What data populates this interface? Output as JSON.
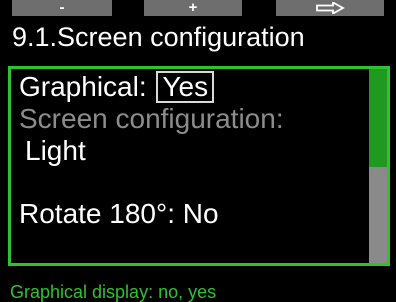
{
  "softkeys": {
    "left_label": "-",
    "middle_label": "+",
    "right_icon": "right-arrow-icon"
  },
  "screen": {
    "title": "9.1.Screen configuration"
  },
  "settings": {
    "graphical_label": "Graphical:",
    "graphical_value": "Yes",
    "screen_config_label": "Screen configuration:",
    "screen_config_value": "Light",
    "rotate_label": "Rotate 180°:",
    "rotate_value": "No"
  },
  "scrollbar": {
    "position_fraction": 0.5
  },
  "help": {
    "text": "Graphical display: no, yes"
  },
  "colors": {
    "accent_green": "#2fc12f",
    "scroll_thumb": "#1f9a1f",
    "softkey_gray": "#6e6e6e",
    "disabled_text": "#8c8c8c"
  }
}
